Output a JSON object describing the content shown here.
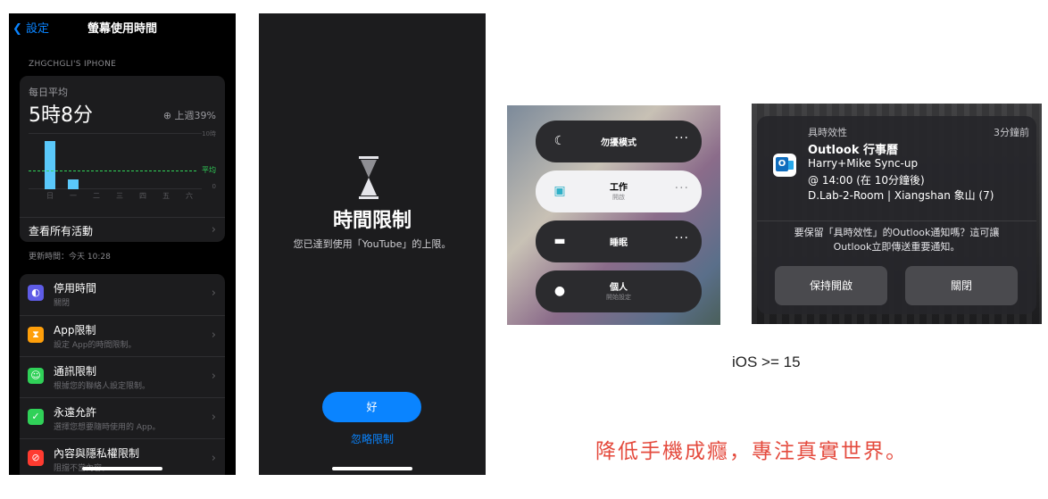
{
  "screen_time": {
    "back_label": "設定",
    "title": "螢幕使用時間",
    "device": "ZHGCHGLI'S IPHONE",
    "daily_avg_label": "每日平均",
    "daily_avg_value": "5時8分",
    "delta": "上週39%",
    "chart": {
      "y_labels": [
        "10時",
        "0"
      ],
      "avg_label": "平均",
      "days": [
        "日",
        "一",
        "二",
        "三",
        "四",
        "五",
        "六"
      ]
    },
    "see_all": "查看所有活動",
    "updated": "更新時間：今天 10:28",
    "rows": [
      {
        "title": "停用時間",
        "sub": "關閉",
        "icon": "downtime-icon",
        "color": "#5e5ce6"
      },
      {
        "title": "App限制",
        "sub": "設定 App的時間限制。",
        "icon": "hourglass-icon",
        "color": "#ff9f0a"
      },
      {
        "title": "通訊限制",
        "sub": "根據您的聯絡人設定限制。",
        "icon": "contact-icon",
        "color": "#30d158"
      },
      {
        "title": "永遠允許",
        "sub": "選擇您想要隨時使用的 App。",
        "icon": "check-icon",
        "color": "#30d158"
      },
      {
        "title": "內容與隱私權限制",
        "sub": "阻擋不當內容。",
        "icon": "block-icon",
        "color": "#ff3b30"
      }
    ]
  },
  "time_limit": {
    "title": "時間限制",
    "message": "您已達到使用「YouTube」的上限。",
    "ok_label": "好",
    "ignore_label": "忽略限制"
  },
  "focus": {
    "modes": [
      {
        "label": "勿擾模式",
        "sub": "",
        "icon": "moon-icon"
      },
      {
        "label": "工作",
        "sub": "開啟",
        "icon": "badge-icon"
      },
      {
        "label": "睡眠",
        "sub": "",
        "icon": "bed-icon"
      },
      {
        "label": "個人",
        "sub": "開始設定",
        "icon": "person-icon"
      }
    ],
    "more": "···"
  },
  "notification": {
    "category": "具時效性",
    "time": "3分鐘前",
    "app_title": "Outlook 行事曆",
    "line1": "Harry+Mike Sync-up",
    "line2": "@ 14:00 (在 10分鐘後)",
    "line3": "D.Lab-2-Room | Xiangshan 象山 (7)",
    "question_1": "要保留「具時效性」的Outlook通知嗎？這可讓",
    "question_2": "Outlook立即傳送重要通知。",
    "keep_label": "保持開啟",
    "close_label": "關閉"
  },
  "caption_ios": "iOS >= 15",
  "slogan": "降低手機成癮，專注真實世界。"
}
